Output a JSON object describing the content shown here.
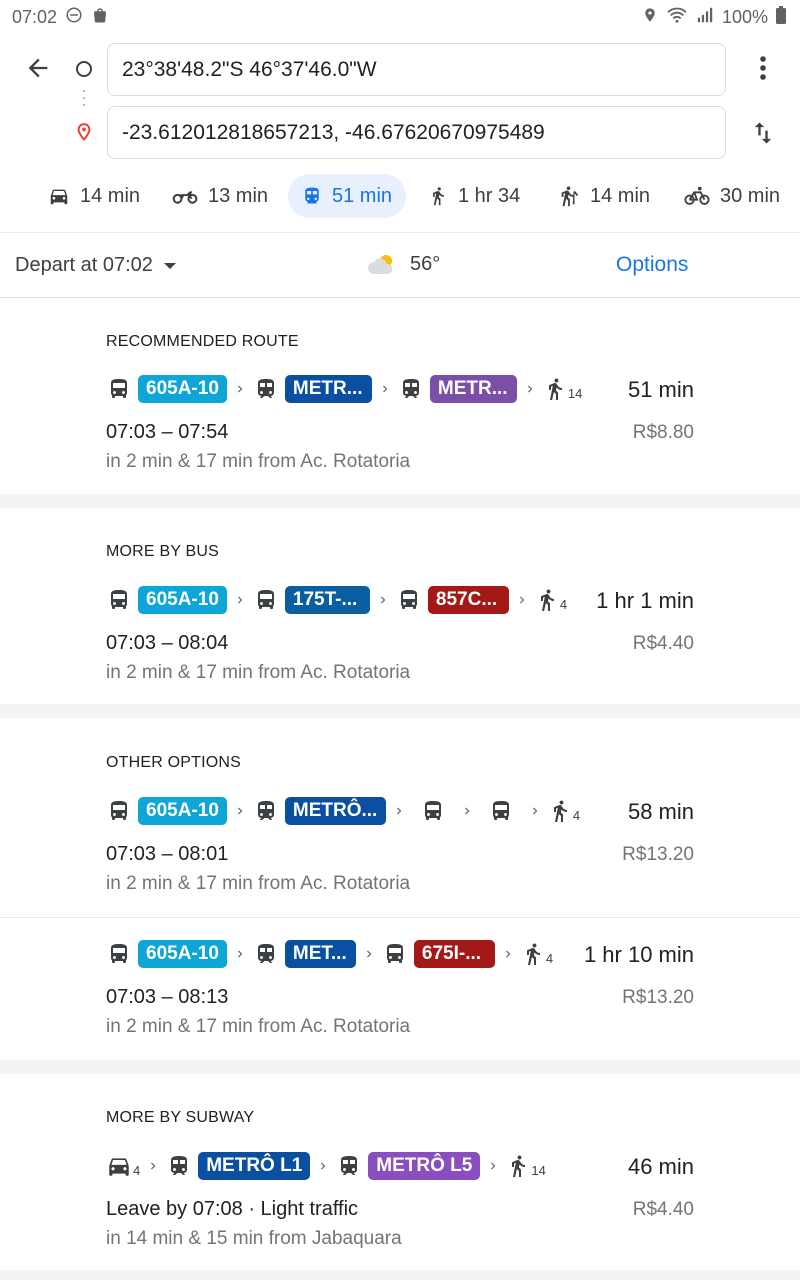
{
  "status": {
    "time": "07:02",
    "battery": "100%"
  },
  "search": {
    "origin": "23°38'48.2\"S 46°37'46.0\"W",
    "destination": "-23.612012818657213, -46.67620670975489"
  },
  "modes": [
    {
      "icon": "car-icon",
      "label": "14 min"
    },
    {
      "icon": "motorcycle-icon",
      "label": "13 min"
    },
    {
      "icon": "transit-icon",
      "label": "51 min",
      "active": true
    },
    {
      "icon": "walk-icon",
      "label": "1 hr 34"
    },
    {
      "icon": "rideshare-icon",
      "label": "14 min"
    },
    {
      "icon": "bike-icon",
      "label": "30 min"
    }
  ],
  "depart": {
    "label": "Depart at 07:02",
    "temperature": "56°",
    "options_label": "Options"
  },
  "colors": {
    "bus_blue": "#0ea5d9",
    "metro_dark_blue": "#0b4fa1",
    "metro_purple": "#7b4fa8",
    "metro_l5": "#8a4fbf",
    "line_blue_dark": "#0a5fa3",
    "line_red": "#a51818",
    "accent": "#1a73e8"
  },
  "sections": [
    {
      "title": "RECOMMENDED ROUTE",
      "routes": [
        {
          "duration": "51 min",
          "times": "07:03 – 07:54",
          "price": "R$8.80",
          "from": "in 2 min & 17 min from Ac. Rotatoria",
          "walk": "14",
          "badges": [
            "605A-10",
            "METR...",
            "METR..."
          ]
        }
      ]
    },
    {
      "title": "MORE BY BUS",
      "routes": [
        {
          "duration": "1 hr 1 min",
          "times": "07:03 – 08:04",
          "price": "R$4.40",
          "from": "in 2 min & 17 min from Ac. Rotatoria",
          "walk": "4",
          "badges": [
            "605A-10",
            "175T-...",
            "857C..."
          ]
        }
      ]
    },
    {
      "title": "OTHER OPTIONS",
      "routes": [
        {
          "duration": "58 min",
          "times": "07:03 – 08:01",
          "price": "R$13.20",
          "from": "in 2 min & 17 min from Ac. Rotatoria",
          "walk": "4",
          "badges": [
            "605A-10",
            "METRÔ..."
          ]
        },
        {
          "duration": "1 hr 10 min",
          "times": "07:03 – 08:13",
          "price": "R$13.20",
          "from": "in 2 min & 17 min from Ac. Rotatoria",
          "walk": "4",
          "badges": [
            "605A-10",
            "MET...",
            "675I-..."
          ]
        }
      ]
    },
    {
      "title": "MORE BY SUBWAY",
      "routes": [
        {
          "duration": "46 min",
          "times": "Leave by 07:08 · Light traffic",
          "price": "R$4.40",
          "from": "in 14 min & 15 min from Jabaquara",
          "drive": "4",
          "walk": "14",
          "badges": [
            "METRÔ L1",
            "METRÔ L5"
          ]
        }
      ]
    }
  ]
}
